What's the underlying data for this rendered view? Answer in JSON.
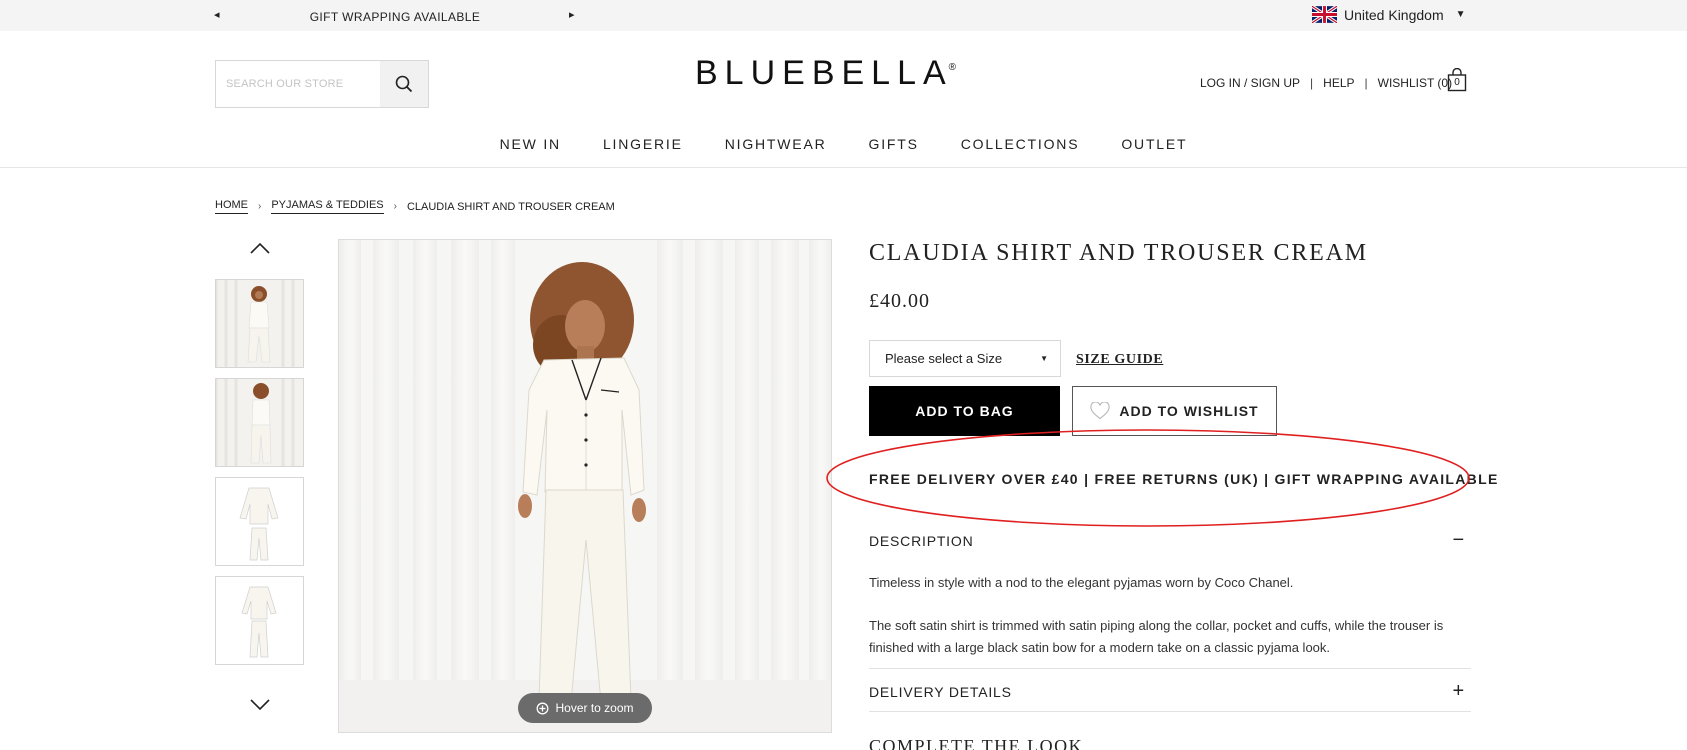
{
  "promo_bar": {
    "prev_arrow": "◂",
    "next_arrow": "▸",
    "message": "GIFT WRAPPING AVAILABLE",
    "country": "United Kingdom",
    "country_caret": "▼"
  },
  "header": {
    "search_placeholder": "SEARCH OUR STORE",
    "logo": "BLUEBELLA",
    "logo_mark": "®",
    "login": "LOG IN / SIGN UP",
    "help": "HELP",
    "wishlist": "WISHLIST (0)",
    "separator": "|",
    "bag_count": "0"
  },
  "nav": [
    "NEW IN",
    "LINGERIE",
    "NIGHTWEAR",
    "GIFTS",
    "COLLECTIONS",
    "OUTLET"
  ],
  "breadcrumb": {
    "home": "HOME",
    "category": "PYJAMAS & TEDDIES",
    "current": "CLAUDIA SHIRT AND TROUSER CREAM",
    "separator": "›"
  },
  "gallery": {
    "thumbnail_count": 4,
    "zoom_hint": "Hover to zoom"
  },
  "product": {
    "title": "CLAUDIA SHIRT AND TROUSER CREAM",
    "price": "£40.00",
    "size_placeholder": "Please select a Size",
    "size_caret": "▼",
    "size_guide": "SIZE GUIDE",
    "add_to_bag": "ADD TO BAG",
    "add_to_wishlist": "ADD TO WISHLIST",
    "delivery_banner": "FREE DELIVERY OVER £40 | FREE RETURNS (UK) | GIFT WRAPPING AVAILABLE"
  },
  "accordion": {
    "description_title": "DESCRIPTION",
    "description_toggle": "−",
    "description_p1": "Timeless in style with a nod to the elegant pyjamas worn by Coco Chanel.",
    "description_p2": "The soft  satin shirt is trimmed with  satin piping along the collar, pocket and cuffs, while the trouser is finished with a large black satin bow for a modern take on a classic pyjama look.",
    "delivery_title": "DELIVERY DETAILS",
    "delivery_toggle": "+",
    "complete_the_look": "COMPLETE THE LOOK"
  },
  "colors": {
    "annotation_ellipse": "#e02020",
    "primary_button": "#000000",
    "promo_bar_bg": "#f4f4f4"
  }
}
